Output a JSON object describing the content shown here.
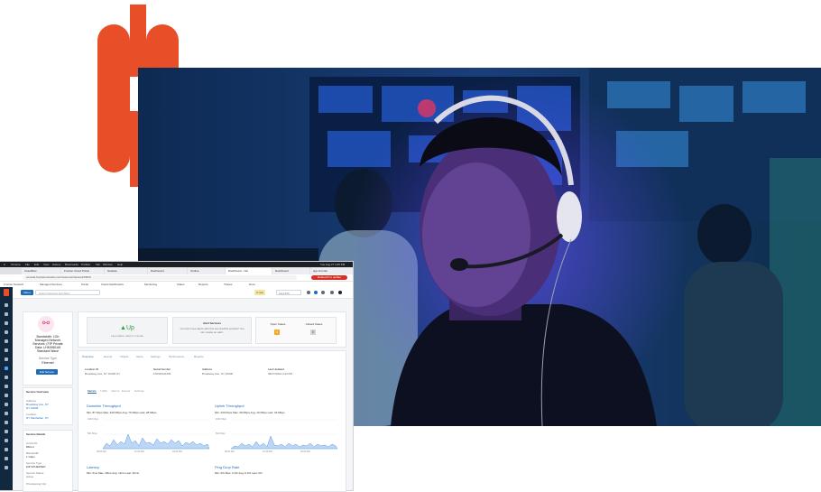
{
  "brand": {
    "logo_color": "#e84e27",
    "accent": "#1f6bb8"
  },
  "mac_menu": [
    "Chrome",
    "File",
    "Edit",
    "View",
    "History",
    "Bookmarks",
    "Profiles",
    "Tab",
    "Window",
    "Help"
  ],
  "mac_clock": "Tue Aug 27 4:45 PM",
  "browser_tabs": [
    "Cloudflare",
    "Frontier Cloud Portal",
    "Netdata",
    "Dashboard",
    "Outline",
    "Dashboard - Net",
    "Dashboard",
    "app.Frontier"
  ],
  "browser": {
    "url": "console.frontiernetworks.com/customer/devices/9f2b6",
    "relaunch": "Relaunch to update"
  },
  "bookmarks": [
    "Frontier Network",
    "Managed Services",
    "Portal",
    "Cloud Dashboards",
    "Monitoring",
    "Status",
    "Reports",
    "Tickets",
    "Docs"
  ],
  "app": {
    "menu_label": "Menu",
    "search_placeholder": "Search Devices and Sites",
    "header_pill": "2 Ups",
    "header_select": "Last 24h"
  },
  "device": {
    "avatar_icon": "share-nodes-icon",
    "name_lines": [
      "Bandwidth: 1Gb",
      "Managed Network",
      "Services | FIP Private",
      "Data: LHK9981A9",
      "Standard Wave"
    ],
    "type_label": "Service Type",
    "type_value": "Ethernet",
    "edit_button": "Edit Service"
  },
  "service_overview": {
    "title": "Service Overview",
    "lines": [
      "Address",
      "Broadway Ave, NY",
      "NY 10006",
      "Location",
      "NY Manhattan, NY"
    ]
  },
  "service_details": {
    "title": "Service Details",
    "lines": [
      "Circuit ID",
      "BDA-2",
      "Bandwidth",
      "1 Gbps",
      "Service Type",
      "EIP ETHERNET",
      "Service Status",
      "Active",
      "Provisioning Info"
    ]
  },
  "status": {
    "up_label": "Up",
    "up_caption": "Last status: about 1 minute",
    "alerts_title": "Alert Services",
    "alerts_text": "You don't see alerts with this service/this product! You can create an alert.",
    "open_cases_label": "Open Cases",
    "open_cases_count": "1",
    "closed_cases_label": "Closed Cases",
    "closed_cases_count": "0"
  },
  "sub_tabs": [
    "Overview",
    "Events",
    "Tickets",
    "Alerts",
    "Settings",
    "Performance",
    "Reports"
  ],
  "details": [
    {
      "label": "Location ID",
      "value": "Broadway Ave, NY 10006 NY"
    },
    {
      "label": "Serial Number",
      "value": "FNX93441299"
    },
    {
      "label": "Address",
      "value": "Broadway Ave, NY 10006"
    },
    {
      "label": "Last Updated",
      "value": "08/27/2024 4:44 PM"
    }
  ],
  "inner_tabs": [
    "Metrics",
    "Traffic",
    "Alarms",
    "Events",
    "Settings"
  ],
  "charts": [
    {
      "title": "Downlink Throughput",
      "stats": "Min: 87 Kbps   Max: 320 Mbps   Avg: 76 Mbps   Last: 28 Mbps",
      "ticks": [
        "1000 Kbps",
        "500 Kbps",
        "0",
        "08:00 AM",
        "12:00 PM",
        "04:00 PM"
      ]
    },
    {
      "title": "Uplink Throughput",
      "stats": "Min: 430 Kbps   Max: 39 Mbps   Avg: 10 Mbps   Last: 23 Mbps",
      "ticks": [
        "1000 Kbps",
        "500 Kbps",
        "0",
        "08:00 AM",
        "12:00 PM",
        "04:00 PM"
      ]
    },
    {
      "title": "Latency",
      "stats": "Min: 6ms   Max: 28ms   Avg: 12ms   Last: 20ms"
    },
    {
      "title": "Ping Drop Rate",
      "stats": "Min: 0%   Max: 0.1%   Avg: 0.0%   Last: 0%"
    }
  ]
}
